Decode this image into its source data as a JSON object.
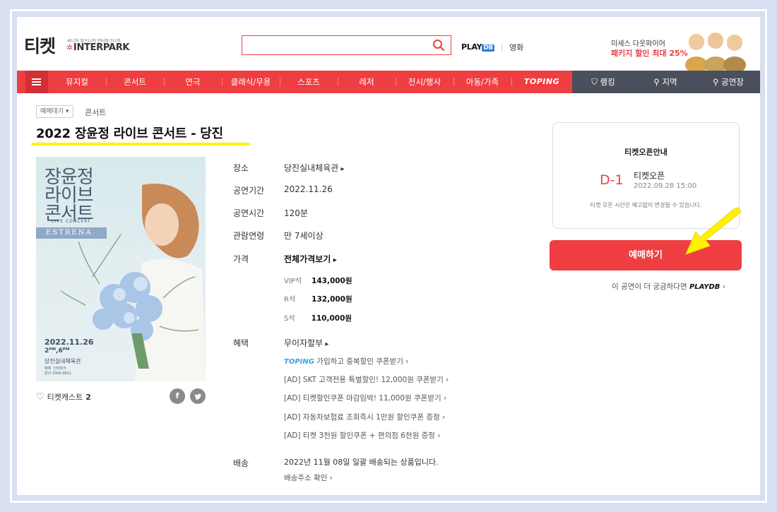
{
  "header": {
    "logo": "티켓",
    "logo_tagline": "써니까 맞으니까 인터파크니까",
    "brand": "INTERPARK",
    "playdb": "PLAY",
    "playdb_db": "DB",
    "movie": "영화",
    "ad_line1": "미세스 다웃파이어",
    "ad_line2": "패키지 할인 최대 25%"
  },
  "nav": {
    "items": [
      "뮤지컬",
      "콘서트",
      "연극",
      "클래식/무용",
      "스포츠",
      "레저",
      "전시/행사",
      "아동/가족",
      "TOPING"
    ],
    "right": [
      "랭킹",
      "지역",
      "공연장"
    ]
  },
  "breadcrumb": {
    "status": "예매대기 ▾",
    "category": "콘서트"
  },
  "title": "2022 장윤정 라이브 콘서트 - 당진",
  "poster": {
    "line1": "장윤정",
    "line2": "라이브",
    "line3": "콘서트",
    "live": "LIVE CONCERT",
    "estrena": "ESTRENA",
    "date": "2022.11.26",
    "time": "2ᴾᴹ,6ᴾᴹ",
    "venue": "당진실내체육관",
    "info": "예매  인터파크\n문의 1566-9621"
  },
  "likes": {
    "label": "티켓캐스트",
    "count": "2"
  },
  "sns": {
    "facebook": "f",
    "twitter": "t"
  },
  "info": {
    "venue_label": "장소",
    "venue": "당진실내체육관",
    "period_label": "공연기간",
    "period": "2022.11.26",
    "runtime_label": "공연시간",
    "runtime": "120분",
    "age_label": "관람연령",
    "age": "만 7세이상",
    "price_label": "가격",
    "price_all": "전체가격보기",
    "prices": [
      {
        "seat": "VIP석",
        "price": "143,000원"
      },
      {
        "seat": "R석",
        "price": "132,000원"
      },
      {
        "seat": "S석",
        "price": "110,000원"
      }
    ],
    "benefit_label": "혜택",
    "benefit_main": "무이자할부",
    "toping": "TOPING",
    "benefits": [
      "가입하고 중복할인 쿠폰받기",
      "[AD] SKT 고객전용 특별할인! 12,000원 쿠폰받기",
      "[AD] 티켓할인쿠폰 마감임박! 11,000원 쿠폰받기",
      "[AD] 자동차보험료 조회즉시 1만원 할인쿠폰 증정",
      "[AD] 티켓 3천원 할인쿠폰 + 편의점 6천원 증정"
    ],
    "delivery_label": "배송",
    "delivery": "2022년 11월 08일 일괄 배송되는 상품입니다.",
    "delivery_link": "배송주소 확인"
  },
  "ticket_open": {
    "title": "티켓오픈안내",
    "dday": "D-1",
    "label": "티켓오픈",
    "date": "2022.09.28 15:00",
    "note": "티켓 오픈 시간은 예고없이 변경될 수 있습니다."
  },
  "book_button": "예매하기",
  "more": {
    "text": "이 공연이 더 궁금하다면",
    "brand": "PLAYDB"
  },
  "colors": {
    "accent": "#ef3e42",
    "nav_dark": "#4a4f5c",
    "highlight": "#fff200"
  }
}
